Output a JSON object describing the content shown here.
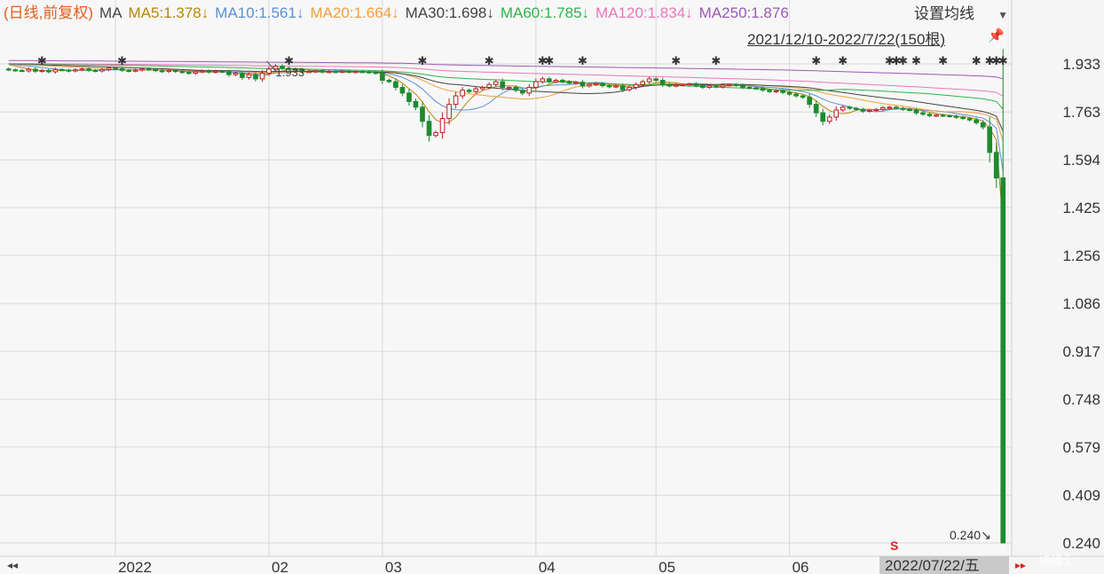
{
  "legend": {
    "title": "(日线,前复权)",
    "ma_label": "MA",
    "title_color": "#e06020",
    "items": [
      {
        "text": "MA5:1.378↓",
        "color": "#b8860b"
      },
      {
        "text": "MA10:1.561↓",
        "color": "#5b8fd6"
      },
      {
        "text": "MA20:1.664↓",
        "color": "#f0a040"
      },
      {
        "text": "MA30:1.698↓",
        "color": "#444444"
      },
      {
        "text": "MA60:1.785↓",
        "color": "#2fb34a"
      },
      {
        "text": "MA120:1.834↓",
        "color": "#e878b8"
      },
      {
        "text": "MA250:1.876",
        "color": "#9b59b6"
      }
    ]
  },
  "settings": {
    "label": "设置均线",
    "caret": "▼"
  },
  "range_label": "2021/12/10-2022/7/22(150根)",
  "pin": "📌",
  "nav": {
    "left": "◂◂",
    "right": "▸▸"
  },
  "current_date": "2022/07/22/五",
  "watermark": "格隆汇",
  "s_marker": "S",
  "last_price_label": "0.240↘",
  "colors": {
    "up": "#c0202a",
    "down": "#1e8a2e",
    "grid": "#d8d8d8",
    "axis_text": "#333333"
  },
  "chart_data": {
    "type": "candlestick",
    "title": "",
    "ylim": [
      0.24,
      1.933
    ],
    "y_ticks": [
      "1.933",
      "1.763",
      "1.594",
      "1.425",
      "1.256",
      "1.086",
      "0.917",
      "0.748",
      "0.579",
      "0.409",
      "0.240"
    ],
    "x_ticks": [
      {
        "label": "2022",
        "index": 16
      },
      {
        "label": "02",
        "index": 39
      },
      {
        "label": "03",
        "index": 56
      },
      {
        "label": "04",
        "index": 79
      },
      {
        "label": "05",
        "index": 97
      },
      {
        "label": "06",
        "index": 117
      }
    ],
    "annotations": [
      {
        "text": "1.933",
        "index": 40,
        "value": 1.933
      }
    ],
    "ma_series": [
      {
        "name": "MA5",
        "last": 1.378,
        "color": "#b8860b"
      },
      {
        "name": "MA10",
        "last": 1.561,
        "color": "#5b8fd6"
      },
      {
        "name": "MA20",
        "last": 1.664,
        "color": "#f0a040"
      },
      {
        "name": "MA30",
        "last": 1.698,
        "color": "#444444"
      },
      {
        "name": "MA60",
        "last": 1.785,
        "color": "#2fb34a"
      },
      {
        "name": "MA120",
        "last": 1.834,
        "color": "#e878b8"
      },
      {
        "name": "MA250",
        "last": 1.876,
        "color": "#9b59b6"
      }
    ],
    "close": [
      1.912,
      1.91,
      1.908,
      1.914,
      1.907,
      1.91,
      1.905,
      1.913,
      1.911,
      1.908,
      1.912,
      1.915,
      1.91,
      1.908,
      1.913,
      1.918,
      1.916,
      1.91,
      1.908,
      1.911,
      1.915,
      1.913,
      1.909,
      1.906,
      1.91,
      1.906,
      1.903,
      1.9,
      1.905,
      1.908,
      1.904,
      1.907,
      1.905,
      1.895,
      1.9,
      1.885,
      1.895,
      1.88,
      1.9,
      1.915,
      1.925,
      1.918,
      1.915,
      1.912,
      1.905,
      1.906,
      1.908,
      1.904,
      1.906,
      1.905,
      1.907,
      1.904,
      1.906,
      1.905,
      1.903,
      1.9,
      1.875,
      1.87,
      1.85,
      1.83,
      1.8,
      1.78,
      1.73,
      1.68,
      1.69,
      1.74,
      1.79,
      1.82,
      1.84,
      1.835,
      1.845,
      1.85,
      1.86,
      1.87,
      1.85,
      1.85,
      1.84,
      1.83,
      1.85,
      1.87,
      1.88,
      1.87,
      1.875,
      1.87,
      1.865,
      1.868,
      1.855,
      1.86,
      1.863,
      1.856,
      1.852,
      1.855,
      1.842,
      1.85,
      1.86,
      1.87,
      1.88,
      1.875,
      1.86,
      1.855,
      1.858,
      1.86,
      1.862,
      1.856,
      1.85,
      1.855,
      1.852,
      1.858,
      1.86,
      1.857,
      1.85,
      1.848,
      1.846,
      1.84,
      1.835,
      1.838,
      1.832,
      1.826,
      1.82,
      1.815,
      1.79,
      1.76,
      1.73,
      1.745,
      1.77,
      1.78,
      1.776,
      1.772,
      1.766,
      1.769,
      1.772,
      1.778,
      1.78,
      1.776,
      1.772,
      1.77,
      1.76,
      1.755,
      1.75,
      1.752,
      1.75,
      1.748,
      1.744,
      1.74,
      1.735,
      1.725,
      1.71,
      1.62,
      1.53,
      0.24
    ]
  }
}
